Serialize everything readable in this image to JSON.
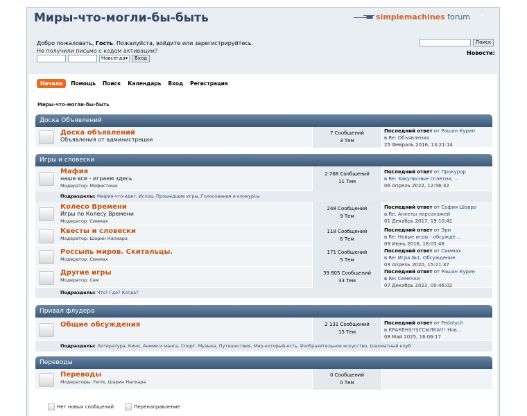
{
  "header": {
    "forum_title": "Миры-что-могли-бы-быть",
    "logo_text_prefix": "simple",
    "logo_text_brand": "machines",
    "logo_text_suffix": " forum",
    "collapse_glyph": "⌃"
  },
  "welcome": {
    "line1_a": "Добро пожаловать, ",
    "line1_guest": "Гость",
    "line1_b": ". Пожалуйста, войдите или зарегистрируйтесь.",
    "line2": "Не получили письмо с кодом активации?"
  },
  "login": {
    "duration": "Навсегда",
    "duration_arrow": "▾",
    "submit": "Вход"
  },
  "search": {
    "button": "Поиск",
    "news_label": "Новости:"
  },
  "menu": [
    "Начало",
    "Помощь",
    "Поиск",
    "Календарь",
    "Вход",
    "Регистрация"
  ],
  "breadcrumb": "Миры-что-могли-бы-быть",
  "categories": [
    {
      "title": "Доска Объявлений",
      "boards": [
        {
          "title": "Доска объявлений",
          "desc": "Объявления от администрации",
          "moderator": "",
          "posts": "7 Сообщений",
          "topics": "3 Тем",
          "last_by": "Рашан Курин",
          "last_in": "Re: Объявления",
          "last_date": "25 Февраль 2016, 13:21:14"
        }
      ],
      "children": ""
    },
    {
      "title": "Игры и словески",
      "boards": [
        {
          "title": "Мафия",
          "desc": "наше все - играем здесь",
          "moderator": "Модератор: Мефистошк",
          "posts": "2 768 Сообщений",
          "topics": "11 Тем",
          "last_by": "Прокурор",
          "last_in": "Re: Закулисные сплетни, ...",
          "last_date": "06 Апрель 2022, 12:56:32",
          "children": "Мафия-что-идет, Исход, Прошедшие игры, Голосования и конкурсы"
        },
        {
          "title": "Колесо Времени",
          "desc": "Игры по Колесу Времени",
          "moderator": "Модератор: Симмах",
          "posts": "248 Сообщений",
          "topics": "9 Тем",
          "last_by": "София Шавро",
          "last_in": "Re: Анкеты персонажей",
          "last_date": "01 Декабрь 2017, 19:10:41"
        },
        {
          "title": "Квесты и словески",
          "desc": "",
          "moderator": "Модератор: Шарин Налхара",
          "posts": "118 Сообщений",
          "topics": "6 Тем",
          "last_by": "Эри",
          "last_in": "Re: Новые игры - обсужде...",
          "last_date": "09 Июнь 2016, 18:03:48"
        },
        {
          "title": "Россыпь миров. Скитальцы.",
          "desc": "",
          "moderator": "Модератор: Симмах",
          "posts": "171 Сообщений",
          "topics": "5 Тем",
          "last_by": "Симмах",
          "last_in": "Re: Игра №1. Обсуждение",
          "last_date": "03 Апрель 2020, 15:21:37"
        },
        {
          "title": "Другие игры",
          "desc": "",
          "moderator": "Модератор: Сем",
          "posts": "39 805 Сообщений",
          "topics": "33 Тем",
          "last_by": "Рашан Курин",
          "last_in": "Re: Семечки",
          "last_date": "07 Декабрь 2022, 00:46:02",
          "children": "Что? Где? Когда?"
        }
      ]
    },
    {
      "title": "Привал флудера",
      "boards": [
        {
          "title": "Общие обсуждения",
          "desc": "",
          "moderator": "",
          "posts": "2 131 Сообщений",
          "topics": "15 Тем",
          "last_by": "Fedotych",
          "last_in": "КРАКЕН$!!$ССЫЛКА!!! Нов...",
          "last_date": "08 Май 2025, 16:06:17",
          "children": "Литература, Кино, Аниме и манга, Спорт, Музыка, Путешествия, Мир-который-есть, Изобразительное искусство, Шахматный клуб"
        }
      ]
    },
    {
      "title": "Переводы",
      "boards": [
        {
          "title": "Переводы",
          "desc": "",
          "moderator": "Модераторы: Fenix, Шарин Налхара",
          "posts": "0 Сообщений",
          "topics": "0 Тем",
          "last_by": "",
          "last_in": "",
          "last_date": ""
        }
      ]
    }
  ],
  "labels": {
    "last_post": "Последний ответ",
    "from": " от ",
    "in": "в ",
    "subforums": "Подразделы:"
  },
  "legend": {
    "no_new": "Нет новых сообщений",
    "redirect": "Перенаправление"
  },
  "colors": {
    "accent": "#e66a20",
    "category_header": "#3c5878",
    "board_title": "#c45510"
  }
}
